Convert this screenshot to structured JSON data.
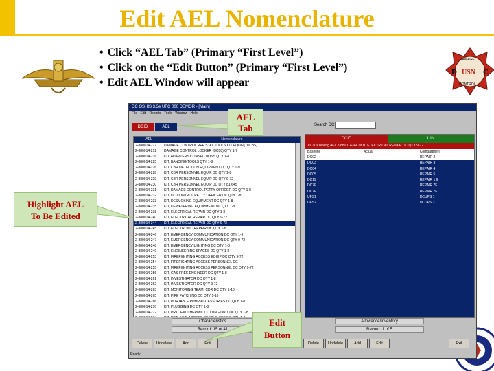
{
  "slide": {
    "title": "Edit AEL Nomenclature",
    "bullets": [
      "Click “AEL Tab” (Primary “First Level”)",
      "Click on the “Edit Button” (Primary “First Level”)",
      "Edit AEL Window will appear"
    ],
    "colors": {
      "title": "#e8b400",
      "callout_text": "#b80000",
      "callout_bg": "#cfe6b8",
      "accent": "#f2c200"
    }
  },
  "callouts": {
    "ael_tab": "AEL Tab",
    "highlight_line1": "Highlight AEL",
    "highlight_line2": "To Be Edited",
    "edit_line1": "Edit",
    "edit_line2": "Button"
  },
  "badges": {
    "right_text": "USN",
    "right_left_letter": "D",
    "right_right_letter": "C",
    "right_top": "DAMAGE",
    "right_bottom": "CONTROL"
  },
  "app": {
    "title": "DC OSHIS 3.3e   UFC 000 DEMOR - [Main]",
    "menu": "File  Edit  Reports  Tools  Window  Help",
    "tabs": {
      "dcid": "DCID",
      "ael": "AEL"
    },
    "search_label": "Search DCID:",
    "ael_headers": [
      "AEL",
      "Nomenclature"
    ],
    "ael_rows": [
      [
        "2-880014-227",
        "DAMAGE CONTROL REP STAT TOOLS KIT EQUIP(7DC8S)"
      ],
      [
        "2-880014-212",
        "DAMAGE CONTROL LOCKER (DC08) QTY 1-7"
      ],
      [
        "2-880014-216",
        "KIT, ADAPTERS CONNECTIONS QTY 1-8"
      ],
      [
        "2-880014-225",
        "KIT, BANDING TOOLS QTY 1-8"
      ],
      [
        "2-880014-226",
        "KIT, CBR DETECTION EQUIPMENT DC QTY 1-9"
      ],
      [
        "2-880014-228",
        "KIT, CBR PERSONNEL EQUIP DC QTY 1-8"
      ],
      [
        "2-880014-229",
        "KIT, CBR PERSONNEL EQUIP DC QTY 9-72"
      ],
      [
        "2-880014-230",
        "KIT, CBR PERSONNEL EQUIP DC QTY 81-645"
      ],
      [
        "2-880014-231",
        "KIT, DAMAGE CONTROL PETTY OFFICER DC QTY 1-8"
      ],
      [
        "2-880014-232",
        "KIT, DC CONTROL PETTY OFFICER DC QTY 1-8"
      ],
      [
        "2-880014-233",
        "KIT, DESMOKING EQUIPMENT DC QTY 1-8"
      ],
      [
        "2-880014-235",
        "KIT, DEWATERING EQUIPMENT DC QTY 1-8"
      ],
      [
        "2-880014-238",
        "KIT, ELECTRICAL REPAIR DC QTY 1-8"
      ],
      [
        "2-880014-240",
        "KIT, ELECTRICAL REPAIR DC QTY 9-72"
      ],
      [
        "2-880014-244",
        "KIT, ELECTRICAL REPAIR DC QTY 9-72"
      ],
      [
        "2-880014-245",
        "KIT, ELECTRONIC REPAIR DC QTY 1-8"
      ],
      [
        "2-880014-246",
        "KIT, EMERGENCY COMMUNICATION DC QTY 1-9"
      ],
      [
        "2-880014-247",
        "KIT, EMERGENCY COMMUNICATION DC QTY 9-72"
      ],
      [
        "2-880014-248",
        "KIT, EMERGENCY LIGHTING DC QTY 1-8"
      ],
      [
        "2-880014-249",
        "KIT, ENGINEERING SPACES DC QTY 1-8"
      ],
      [
        "2-880014-253",
        "KIT, FIREFIGHTING ACCESS EQUIP DC QTY 9-72"
      ],
      [
        "2-880014-254",
        "KIT, FIREFIGHTING ACCESS PERSONNEL DC"
      ],
      [
        "2-880014-255",
        "KIT, FIREFIGHTING ACCESS PERSONNEL DC QTY 9-72"
      ],
      [
        "2-880014-256",
        "KIT, GAS FREE ENGINEER DC QTY 1-8"
      ],
      [
        "2-880014-261",
        "KIT, INVESTIGATOR DC QTY 1-8"
      ],
      [
        "2-880014-262",
        "KIT, INVESTIGATOR DC QTY 9-72"
      ],
      [
        "2-880014-263",
        "KIT, MONITORING TEAM, CDR DC QTY 1-10"
      ],
      [
        "2-880014-265",
        "KIT, PIPE PATCHING DC QTY 1-10"
      ],
      [
        "2-880014-266",
        "KIT, PORTABLE PUMP ACCESSORIES DC QTY 1-8"
      ],
      [
        "2-880014-270",
        "KIT, PLUGGING DC QTY 1-8"
      ],
      [
        "2-880014-272",
        "KIT, PRTL EXOTHERMIC CUTTING UNIT DC QTY 1-8"
      ],
      [
        "2-880014-274",
        "KIT, PRTL HYD ACCESS RESCUE SYS DC QTY 1-8"
      ],
      [
        "2-880014-277",
        "KIT, REPAIR LOCKER TOOLS DC QTY 1-8"
      ]
    ],
    "ael_selected_index": 14,
    "dcid_tabs": {
      "left": "DCID",
      "right": "UIN"
    },
    "dcid_caption": "DCIDs having AEL 2-880014244 / KIT, ELECTRICAL REPAIR DC QTY 9-72",
    "dcid_headers": [
      "Baseline",
      "Actual",
      "Compartment"
    ],
    "dcid_rows": [
      [
        "DC02",
        "",
        "REPAIR 2"
      ],
      [
        "DC03",
        "",
        "REPAIR 3"
      ],
      [
        "DC04",
        "",
        "REPAIR 4"
      ],
      [
        "DC05",
        "",
        "REPAIR 5"
      ],
      [
        "DC11",
        "",
        "REPAIR 1 II"
      ],
      [
        "DC7F",
        "",
        "REPAIR 7F"
      ],
      [
        "DC7F",
        "",
        "REPAIR 7F"
      ],
      [
        "UFS1",
        "",
        "DCUPS 1"
      ],
      [
        "UFS2",
        "",
        "DCUPS 2"
      ]
    ],
    "dcid_selected_index": 0,
    "footer": {
      "characteristics": "Characteristics",
      "record_left": "Record: 15 of 41",
      "allowance": "Allowance/Inventory",
      "record_right": "Record: 1 of 5"
    },
    "buttons_left": [
      "Delete",
      "Undelete",
      "Add",
      "Edit"
    ],
    "buttons_right": [
      "Delete",
      "Undelete",
      "Add",
      "Edit"
    ],
    "exit": "Exit",
    "status": "Ready"
  }
}
